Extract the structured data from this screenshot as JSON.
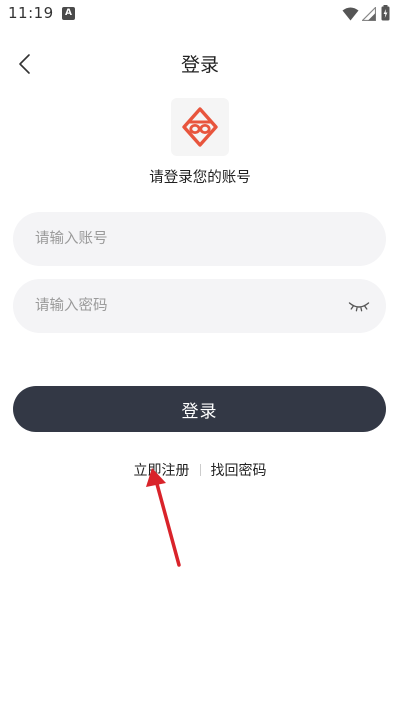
{
  "status_bar": {
    "time": "11:19",
    "notification_icon": "a-notification-icon",
    "wifi_icon": "wifi-icon",
    "signal_icon": "signal-icon",
    "battery_icon": "battery-charging-icon"
  },
  "header": {
    "back_icon": "chevron-left-icon",
    "title": "登录"
  },
  "logo": {
    "icon": "app-logo-icon",
    "accent_color": "#e8553d"
  },
  "subtitle": "请登录您的账号",
  "form": {
    "account_placeholder": "请输入账号",
    "account_value": "",
    "password_placeholder": "请输入密码",
    "password_value": "",
    "password_toggle_icon": "eye-closed-icon",
    "login_label": "登录"
  },
  "links": {
    "register": "立即注册",
    "forgot_password": "找回密码"
  },
  "colors": {
    "button_bg": "#333845",
    "input_bg": "#f4f4f6",
    "annotation_arrow": "#d9232a"
  }
}
